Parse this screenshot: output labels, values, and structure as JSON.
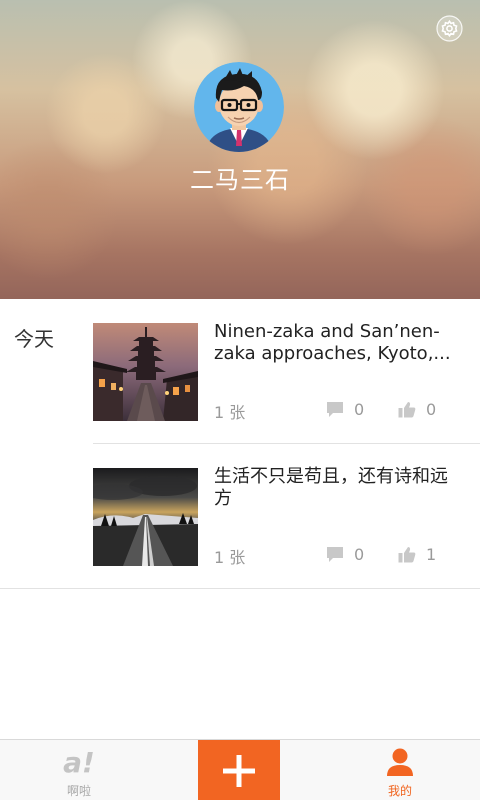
{
  "profile": {
    "user_name": "二马三石"
  },
  "feed": {
    "day_label": "今天",
    "posts": [
      {
        "title": "Ninen-zaka and San’nen-zaka approaches, Kyoto,...",
        "photo_count": "1 张",
        "comments": "0",
        "likes": "0"
      },
      {
        "title": "生活不只是苟且，还有诗和远方",
        "photo_count": "1 张",
        "comments": "0",
        "likes": "1"
      }
    ]
  },
  "tab_bar": {
    "home_label": "啊啦",
    "mine_label": "我的",
    "home_icon_text": "a!"
  },
  "colors": {
    "accent": "#f26522",
    "muted_icon": "#c8c8c8"
  }
}
